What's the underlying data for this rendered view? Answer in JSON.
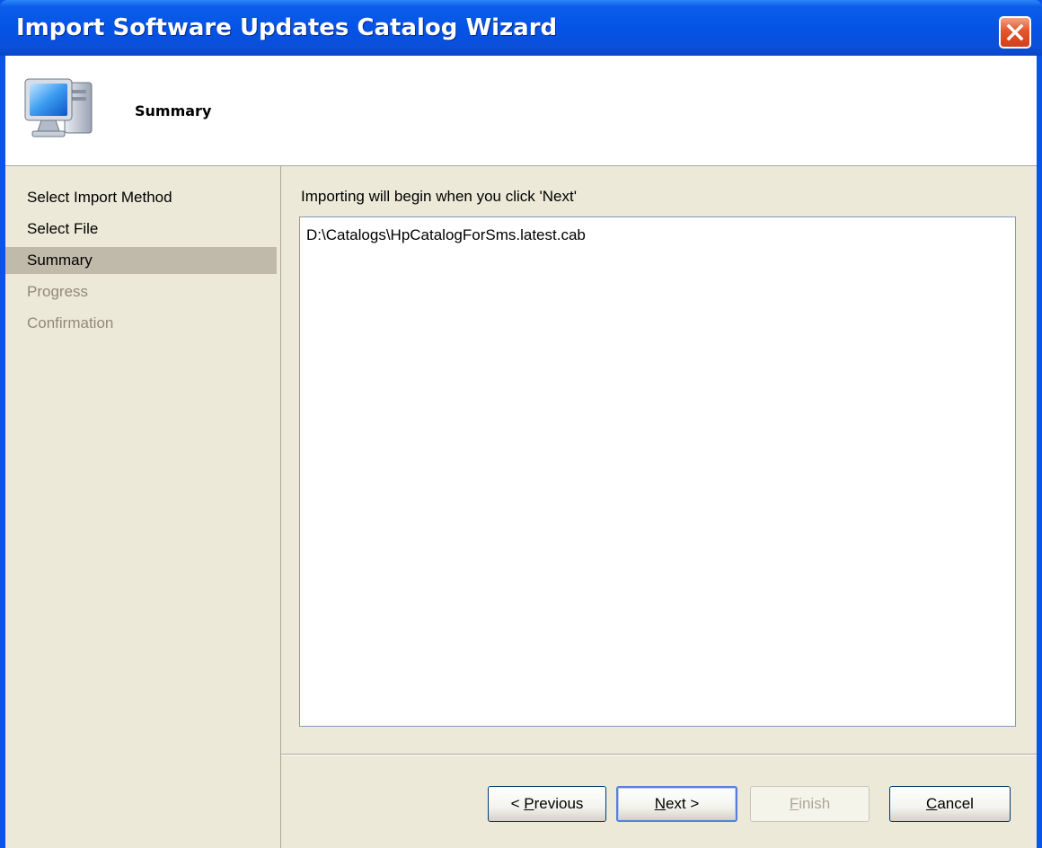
{
  "window": {
    "title": "Import Software Updates Catalog Wizard"
  },
  "header": {
    "title": "Summary",
    "icon": "computer-icon"
  },
  "nav": {
    "items": [
      {
        "label": "Select Import Method",
        "state": "done"
      },
      {
        "label": "Select File",
        "state": "done"
      },
      {
        "label": "Summary",
        "state": "active"
      },
      {
        "label": "Progress",
        "state": "disabled"
      },
      {
        "label": "Confirmation",
        "state": "disabled"
      }
    ]
  },
  "content": {
    "label": "Importing will begin when you click 'Next'",
    "summary_line": "D:\\Catalogs\\HpCatalogForSms.latest.cab"
  },
  "buttons": {
    "previous": {
      "prefix": "< ",
      "mnemonic": "P",
      "rest": "revious"
    },
    "next": {
      "mnemonic": "N",
      "rest": "ext >"
    },
    "finish": {
      "mnemonic": "F",
      "rest": "inish"
    },
    "cancel": {
      "mnemonic": "C",
      "rest": "ancel"
    }
  },
  "colors": {
    "titlebar": "#0553E6",
    "face": "#ECE9D8",
    "active_nav": "#C0BAAA",
    "close": "#D1401A"
  }
}
